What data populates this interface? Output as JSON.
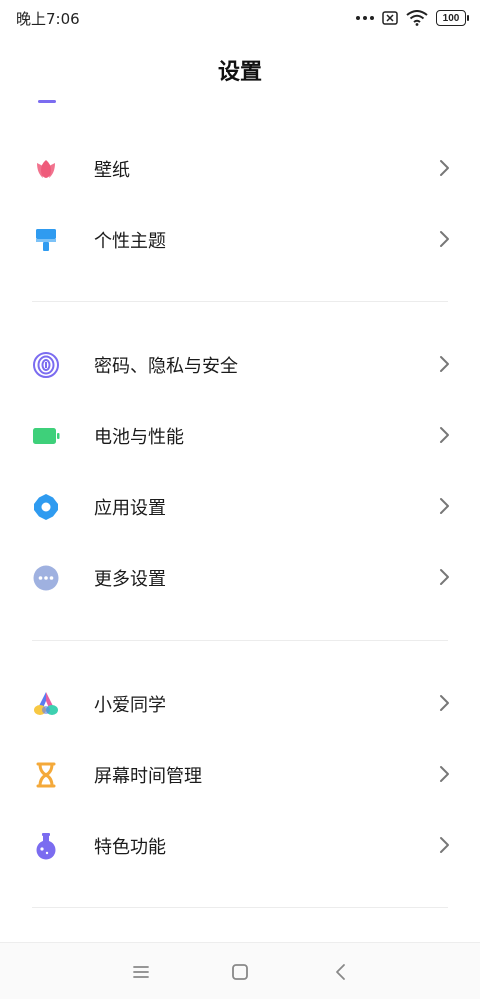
{
  "status_bar": {
    "time": "晚上7:06",
    "battery": "100",
    "icons": [
      "more-dots-icon",
      "no-sim-icon",
      "wifi-icon",
      "battery-icon"
    ]
  },
  "header": {
    "title": "设置"
  },
  "settings_groups": [
    {
      "items": [
        {
          "label": "壁纸",
          "icon": "wallpaper-icon",
          "color": "#ef5b7a"
        },
        {
          "label": "个性主题",
          "icon": "theme-brush-icon",
          "color": "#2f9bf0"
        }
      ]
    },
    {
      "items": [
        {
          "label": "密码、隐私与安全",
          "icon": "fingerprint-icon",
          "color": "#7b6cf0"
        },
        {
          "label": "电池与性能",
          "icon": "battery-icon",
          "color": "#3ed07a"
        },
        {
          "label": "应用设置",
          "icon": "gear-icon",
          "color": "#2f9bf0"
        },
        {
          "label": "更多设置",
          "icon": "more-icon",
          "color": "#9fb1e0"
        }
      ]
    },
    {
      "items": [
        {
          "label": "小爱同学",
          "icon": "xiaoai-icon",
          "color": "#5b7bf0"
        },
        {
          "label": "屏幕时间管理",
          "icon": "hourglass-icon",
          "color": "#f4a93a"
        },
        {
          "label": "特色功能",
          "icon": "flask-icon",
          "color": "#7b6cf0"
        }
      ]
    }
  ],
  "nav_bar": {
    "icons": [
      "menu-icon",
      "home-icon",
      "back-icon"
    ]
  }
}
